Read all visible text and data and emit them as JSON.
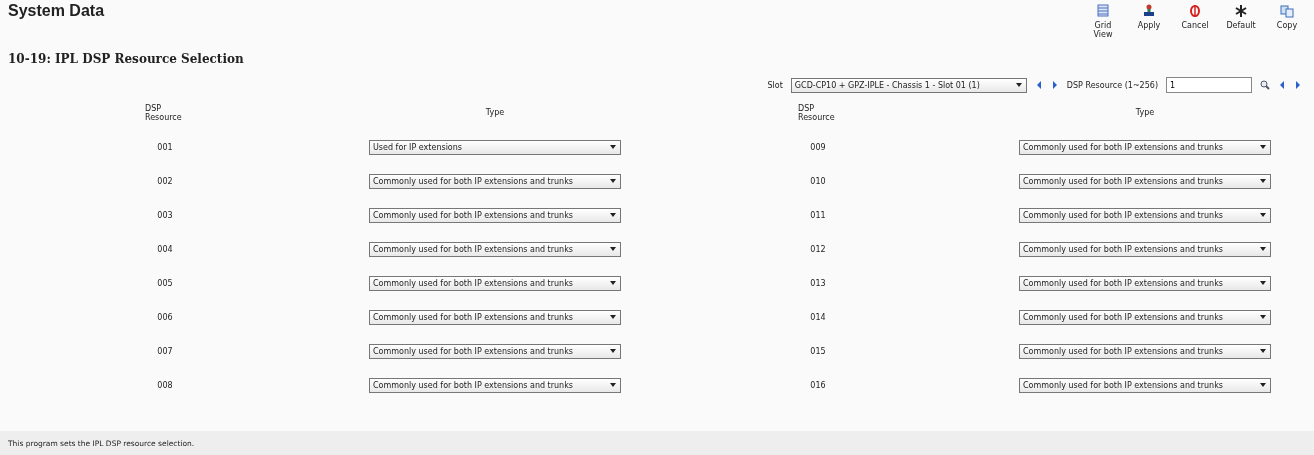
{
  "header": {
    "title": "System Data",
    "subtitle": "10-19: IPL DSP Resource Selection"
  },
  "toolbar": [
    {
      "label": "Grid View",
      "kind": "grid"
    },
    {
      "label": "Apply",
      "kind": "apply"
    },
    {
      "label": "Cancel",
      "kind": "cancel"
    },
    {
      "label": "Default",
      "kind": "default"
    },
    {
      "label": "Copy",
      "kind": "copy"
    }
  ],
  "filter": {
    "slot_label": "Slot",
    "slot_value": "GCD-CP10 + GPZ-IPLE - Chassis 1 - Slot 01 (1)",
    "range_label": "DSP Resource (1~256)",
    "range_value": "1"
  },
  "table": {
    "columns": [
      "DSP Resource",
      "Type",
      "DSP Resource",
      "Type"
    ],
    "rows": [
      {
        "left": {
          "resource": "001",
          "type": "Used for IP extensions"
        },
        "right": {
          "resource": "009",
          "type": "Commonly used for both IP extensions and trunks"
        }
      },
      {
        "left": {
          "resource": "002",
          "type": "Commonly used for both IP extensions and trunks"
        },
        "right": {
          "resource": "010",
          "type": "Commonly used for both IP extensions and trunks"
        }
      },
      {
        "left": {
          "resource": "003",
          "type": "Commonly used for both IP extensions and trunks"
        },
        "right": {
          "resource": "011",
          "type": "Commonly used for both IP extensions and trunks"
        }
      },
      {
        "left": {
          "resource": "004",
          "type": "Commonly used for both IP extensions and trunks"
        },
        "right": {
          "resource": "012",
          "type": "Commonly used for both IP extensions and trunks"
        }
      },
      {
        "left": {
          "resource": "005",
          "type": "Commonly used for both IP extensions and trunks"
        },
        "right": {
          "resource": "013",
          "type": "Commonly used for both IP extensions and trunks"
        }
      },
      {
        "left": {
          "resource": "006",
          "type": "Commonly used for both IP extensions and trunks"
        },
        "right": {
          "resource": "014",
          "type": "Commonly used for both IP extensions and trunks"
        }
      },
      {
        "left": {
          "resource": "007",
          "type": "Commonly used for both IP extensions and trunks"
        },
        "right": {
          "resource": "015",
          "type": "Commonly used for both IP extensions and trunks"
        }
      },
      {
        "left": {
          "resource": "008",
          "type": "Commonly used for both IP extensions and trunks"
        },
        "right": {
          "resource": "016",
          "type": "Commonly used for both IP extensions and trunks"
        }
      }
    ]
  },
  "status_bar": "This program sets the IPL DSP resource selection."
}
